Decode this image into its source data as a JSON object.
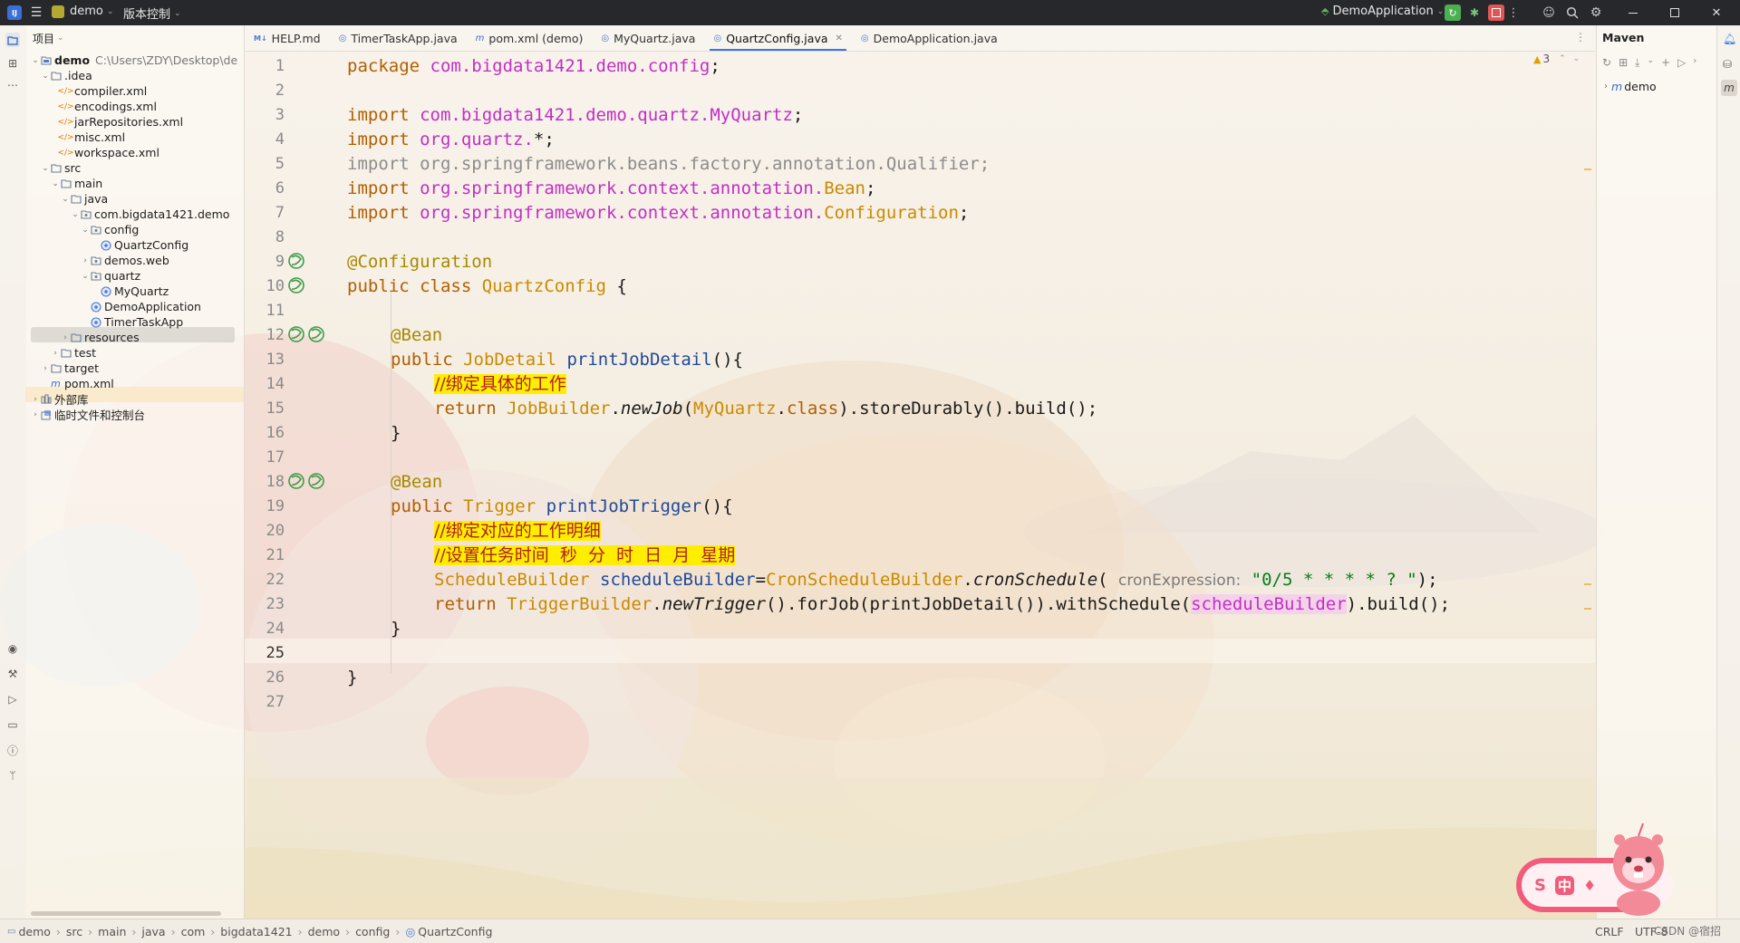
{
  "titlebar": {
    "project": "demo",
    "vcs": "版本控制",
    "run_config": "DemoApplication"
  },
  "project_panel": {
    "title": "项目",
    "tree": [
      {
        "label": "demo",
        "extra": "C:\\Users\\ZDY\\Desktop\\de",
        "icon": "module",
        "bold": true
      },
      {
        "label": ".idea",
        "icon": "folder"
      },
      {
        "label": "compiler.xml",
        "icon": "xml"
      },
      {
        "label": "encodings.xml",
        "icon": "xml"
      },
      {
        "label": "jarRepositories.xml",
        "icon": "xml"
      },
      {
        "label": "misc.xml",
        "icon": "xml"
      },
      {
        "label": "workspace.xml",
        "icon": "xml"
      },
      {
        "label": "src",
        "icon": "folder"
      },
      {
        "label": "main",
        "icon": "folder"
      },
      {
        "label": "java",
        "icon": "folder"
      },
      {
        "label": "com.bigdata1421.demo",
        "icon": "package"
      },
      {
        "label": "config",
        "icon": "package"
      },
      {
        "label": "QuartzConfig",
        "icon": "class"
      },
      {
        "label": "demos.web",
        "icon": "package"
      },
      {
        "label": "quartz",
        "icon": "package"
      },
      {
        "label": "MyQuartz",
        "icon": "class"
      },
      {
        "label": "DemoApplication",
        "icon": "class"
      },
      {
        "label": "TimerTaskApp",
        "icon": "class"
      },
      {
        "label": "resources",
        "icon": "folder"
      },
      {
        "label": "test",
        "icon": "folder"
      },
      {
        "label": "target",
        "icon": "folder"
      },
      {
        "label": "pom.xml",
        "icon": "maven"
      },
      {
        "label": "外部库",
        "icon": "library"
      },
      {
        "label": "临时文件和控制台",
        "icon": "scratch"
      }
    ]
  },
  "tabs": [
    {
      "label": "HELP.md",
      "icon": "md"
    },
    {
      "label": "TimerTaskApp.java",
      "icon": "class"
    },
    {
      "label": "pom.xml (demo)",
      "icon": "maven"
    },
    {
      "label": "MyQuartz.java",
      "icon": "class"
    },
    {
      "label": "QuartzConfig.java",
      "icon": "class",
      "active": true
    },
    {
      "label": "DemoApplication.java",
      "icon": "class"
    }
  ],
  "editor": {
    "warnings": "3",
    "line_numbers": [
      "1",
      "2",
      "3",
      "4",
      "5",
      "6",
      "7",
      "8",
      "9",
      "10",
      "11",
      "12",
      "13",
      "14",
      "15",
      "16",
      "17",
      "18",
      "19",
      "20",
      "21",
      "22",
      "23",
      "24",
      "25",
      "26",
      "27"
    ],
    "code": {
      "l1_kw": "package ",
      "l1_pkg": "com.bigdata1421.demo.config",
      "l1_end": ";",
      "l3_kw": "import ",
      "l3_pkg": "com.bigdata1421.demo.quartz.MyQuartz",
      "l3_end": ";",
      "l4_kw": "import ",
      "l4_pkg": "org.quartz.",
      "l4_end": "*;",
      "l5": "import org.springframework.beans.factory.annotation.Qualifier;",
      "l6_kw": "import ",
      "l6_pkg": "org.springframework.context.annotation.",
      "l6_cls": "Bean",
      "l6_end": ";",
      "l7_kw": "import ",
      "l7_pkg": "org.springframework.context.annotation.",
      "l7_cls": "Configuration",
      "l7_end": ";",
      "l9": "@Configuration",
      "l10_kw": "public class ",
      "l10_cls": "QuartzConfig",
      "l10_end": " {",
      "l12": "@Bean",
      "l13_kw": "public ",
      "l13_cls": "JobDetail",
      "l13_mth": "printJobDetail",
      "l13_end": "(){",
      "l14": "//绑定具体的工作",
      "l15_kw": "return ",
      "l15_cls": "JobBuilder",
      "l15_dot": ".",
      "l15_it": "newJob",
      "l15_p": "(",
      "l15_cls2": "MyQuartz",
      "l15_dot2": ".",
      "l15_kw2": "class",
      "l15_end": ").storeDurably().build();",
      "l16": "}",
      "l18": "@Bean",
      "l19_kw": "public ",
      "l19_cls": "Trigger",
      "l19_mth": "printJobTrigger",
      "l19_end": "(){",
      "l20": "//绑定对应的工作明细",
      "l21": "//设置任务时间  秒  分  时  日  月  星期",
      "l22_cls": "ScheduleBuilder",
      "l22_var": " scheduleBuilder",
      "l22_eq": "=",
      "l22_cls2": "CronScheduleBuilder",
      "l22_dot": ".",
      "l22_it": "cronSchedule",
      "l22_p": "( ",
      "l22_hint": "cronExpression:",
      "l22_str": " \"0/5 * * * * ? \"",
      "l22_end": ");",
      "l23_kw": "return ",
      "l23_cls": "TriggerBuilder",
      "l23_dot": ".",
      "l23_it": "newTrigger",
      "l23_mid": "().forJob(printJobDetail()).withSchedule(",
      "l23_var": "scheduleBuilder",
      "l23_end": ").build();",
      "l24": "}",
      "l26": "}"
    }
  },
  "maven": {
    "title": "Maven",
    "root": "demo"
  },
  "status": {
    "breadcrumbs": [
      "demo",
      "src",
      "main",
      "java",
      "com",
      "bigdata1421",
      "demo",
      "config",
      "QuartzConfig"
    ],
    "line_sep": "CRLF",
    "encoding": "UTF-8",
    "watermark": "CSDN @宿招"
  },
  "widget": {
    "chars": [
      "S",
      "中",
      "♦"
    ]
  }
}
